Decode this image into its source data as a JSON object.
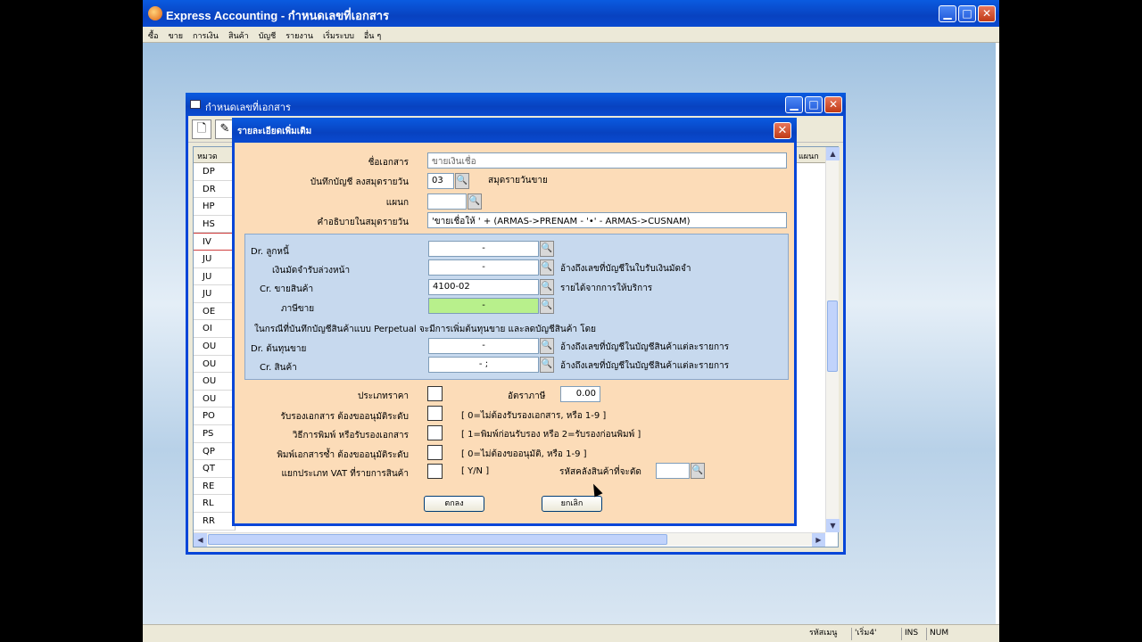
{
  "app": {
    "title": "Express Accounting - กำหนดเลขที่เอกสาร",
    "menu": [
      "ซื้อ",
      "ขาย",
      "การเงิน",
      "สินค้า",
      "บัญชี",
      "รายงาน",
      "เริ่มระบบ",
      "อื่น ๆ"
    ],
    "minimize": "▁",
    "maximize": "□",
    "close": "✕"
  },
  "statusbar": {
    "code_label": "รหัสเมนู",
    "code_value": "'เริ่ม4'",
    "ins": "INS",
    "num": "NUM"
  },
  "docwin": {
    "title": "กำหนดเลขที่เอกสาร",
    "col_header": "หมวด",
    "col_header_right": "แผนก",
    "codes": [
      "DP",
      "DR",
      "HP",
      "HS",
      "IV",
      "JU",
      "JU",
      "JU",
      "OE",
      "OI",
      "OU",
      "OU",
      "OU",
      "OU",
      "PO",
      "PS",
      "QP",
      "QT",
      "RE",
      "RL",
      "RR"
    ],
    "selected_index": 4
  },
  "dialog": {
    "title": "รายละเอียดเพิ่มเติม",
    "close": "✕",
    "doc_name_label": "ชื่อเอกสาร",
    "doc_name_value": "ขายเงินเชื่อ",
    "journal_label": "บันทึกบัญชี ลงสมุดรายวัน",
    "journal_value": "03",
    "journal_desc": "สมุดรายวันขาย",
    "dept_label": "แผนก",
    "dept_value": "",
    "desc_label": "คำอธิบายในสมุดรายวัน",
    "desc_value": "'ขายเชื่อให้   ' + (ARMAS->PRENAM - '•' - ARMAS->CUSNAM)",
    "dr_debtor_label": "Dr.  ลูกหนี้",
    "dr_debtor_value": "-",
    "deposit_label": "เงินมัดจำรับล่วงหน้า",
    "deposit_value": "-",
    "deposit_desc": "อ้างถึงเลขที่บัญชีในใบรับเงินมัดจำ",
    "cr_sales_label": "Cr.  ขายสินค้า",
    "cr_sales_value": "4100-02",
    "cr_sales_desc": "รายได้จากการให้บริการ",
    "tax_label": "ภาษีขาย",
    "tax_value": "-",
    "perpetual_note": "ในกรณีที่บันทึกบัญชีสินค้าแบบ Perpetual  จะมีการเพิ่มต้นทุนขาย และลดบัญชีสินค้า  โดย",
    "dr_cost_label": "Dr.  ต้นทุนขาย",
    "dr_cost_value": "-",
    "dr_cost_desc": "อ้างถึงเลขที่บัญชีในบัญชีสินค้าแต่ละรายการ",
    "cr_goods_label": "Cr.   สินค้า",
    "cr_goods_value": "-           ;",
    "cr_goods_desc": "อ้างถึงเลขที่บัญชีในบัญชีสินค้าแต่ละรายการ",
    "price_type_label": "ประเภทราคา",
    "tax_rate_label": "อัตราภาษี",
    "tax_rate_value": "0.00",
    "approve_label": "รับรองเอกสาร ต้องขออนุมัติระดับ",
    "approve_hint": "[ 0=ไม่ต้องรับรองเอกสาร,  หรือ 1-9 ]",
    "print_label": "วิธีการพิมพ์ หรือรับรองเอกสาร",
    "print_hint": "[ 1=พิมพ์ก่อนรับรอง  หรือ 2=รับรองก่อนพิมพ์ ]",
    "reprint_label": "พิมพ์เอกสารซ้ำ ต้องขออนุมัติระดับ",
    "reprint_hint": "[ 0=ไม่ต้องขออนุมัติ,  หรือ 1-9 ]",
    "vat_label": "แยกประเภท VAT ที่รายการสินค้า",
    "vat_hint": "[ Y/N ]",
    "warehouse_label": "รหัสคลังสินค้าที่จะตัด",
    "ok": "ตกลง",
    "cancel": "ยกเลิก"
  }
}
